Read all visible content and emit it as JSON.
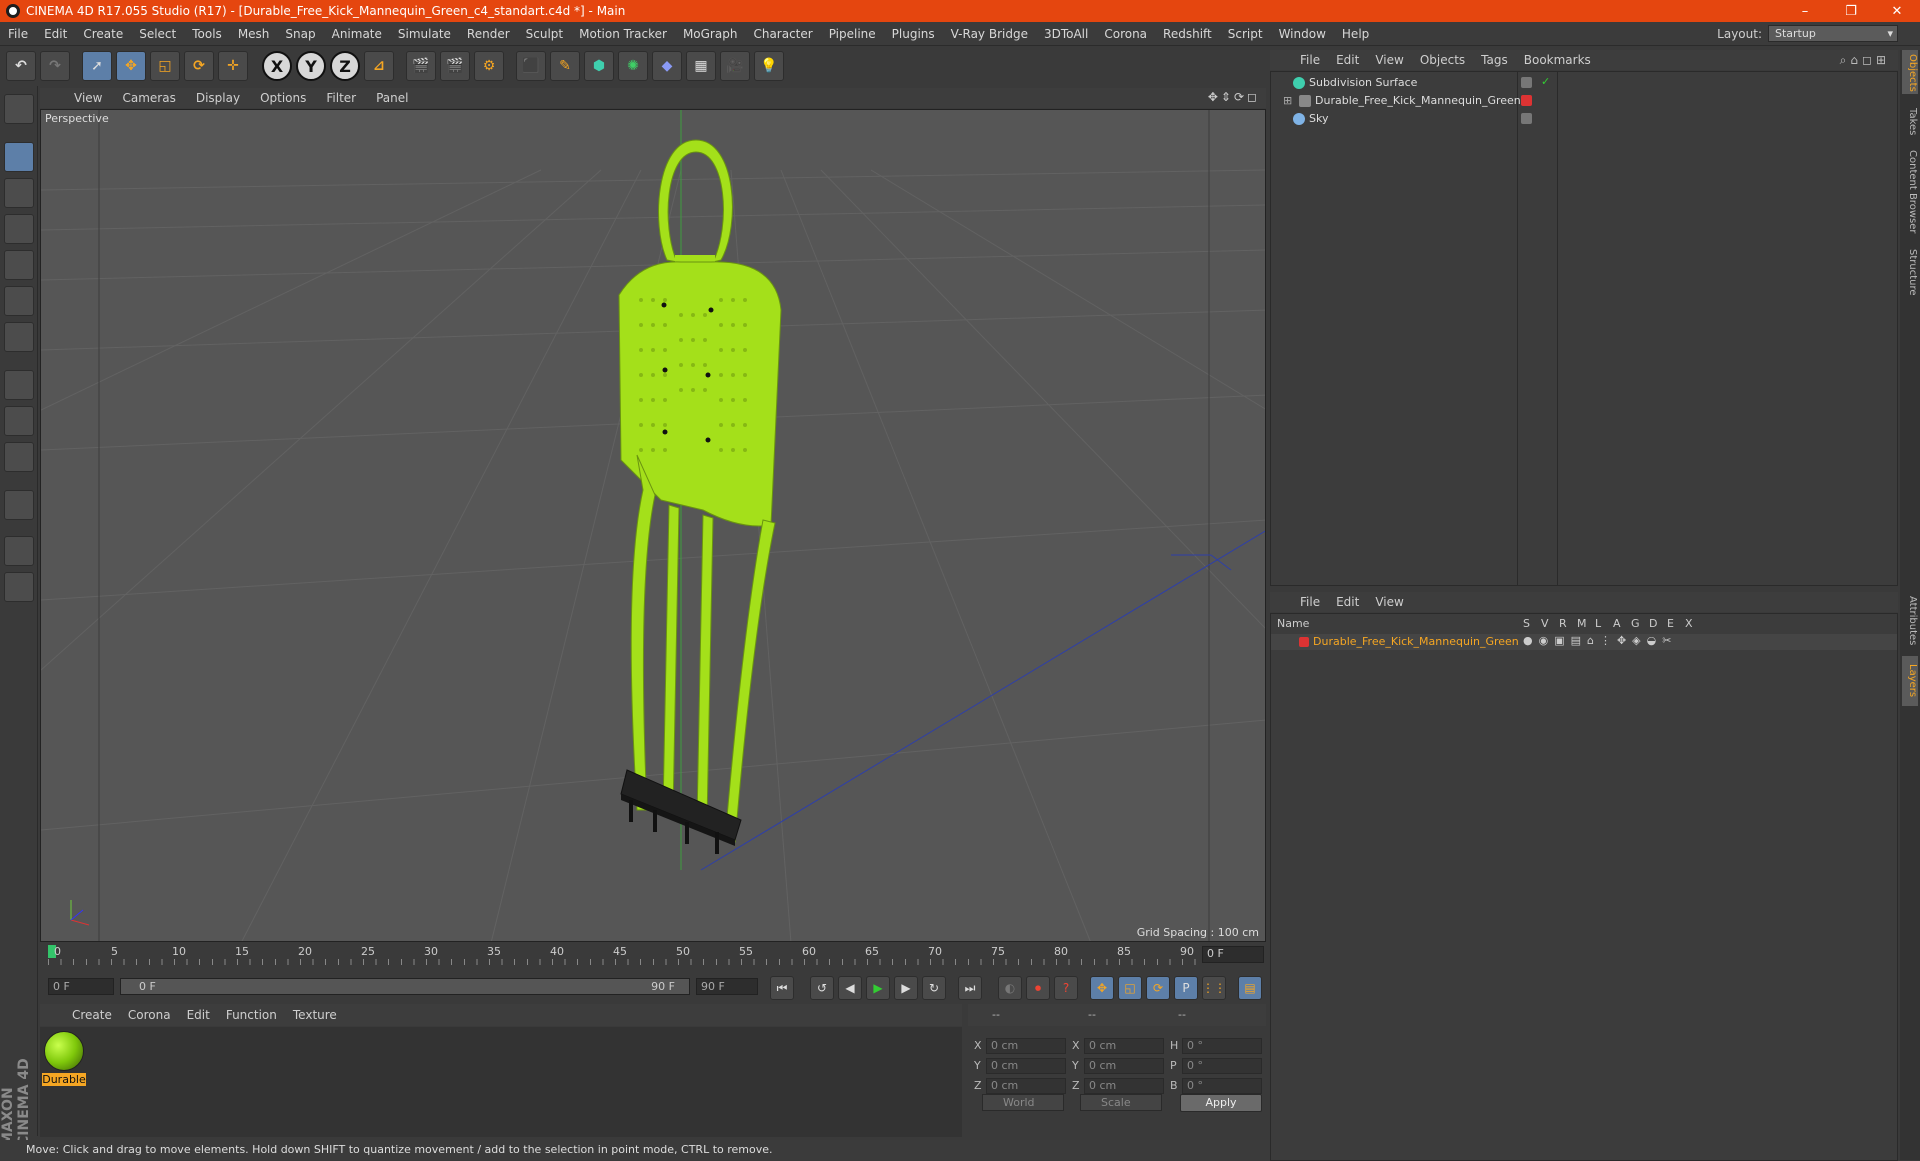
{
  "window": {
    "title": "CINEMA 4D R17.055 Studio (R17) - [Durable_Free_Kick_Mannequin_Green_c4_standart.c4d *] - Main",
    "minimize": "–",
    "restore": "❐",
    "close": "✕"
  },
  "menubar": {
    "items": [
      "File",
      "Edit",
      "Create",
      "Select",
      "Tools",
      "Mesh",
      "Snap",
      "Animate",
      "Simulate",
      "Render",
      "Sculpt",
      "Motion Tracker",
      "MoGraph",
      "Character",
      "Pipeline",
      "Plugins",
      "V-Ray Bridge",
      "3DToAll",
      "Corona",
      "Redshift",
      "Script",
      "Window",
      "Help"
    ],
    "layout_label": "Layout:",
    "layout_value": "Startup"
  },
  "toolbar": {
    "axis_x": "X",
    "axis_y": "Y",
    "axis_z": "Z"
  },
  "viewport": {
    "menu": [
      "View",
      "Cameras",
      "Display",
      "Options",
      "Filter",
      "Panel"
    ],
    "label": "Perspective",
    "grid_spacing": "Grid Spacing : 100 cm",
    "object_color": "#a4e01a"
  },
  "timeline": {
    "ticks": [
      "0",
      "5",
      "10",
      "15",
      "20",
      "25",
      "30",
      "35",
      "40",
      "45",
      "50",
      "55",
      "60",
      "65",
      "70",
      "75",
      "80",
      "85",
      "90"
    ],
    "current_frame": "0 F"
  },
  "transport": {
    "start_field": "0 F",
    "range_start": "0 F",
    "range_end": "90 F",
    "end_field": "90 F"
  },
  "material_manager": {
    "menu": [
      "Create",
      "Corona",
      "Edit",
      "Function",
      "Texture"
    ],
    "materials": [
      {
        "name": "Durable"
      }
    ]
  },
  "coordinates": {
    "header": [
      "--",
      "--",
      "--"
    ],
    "rows": [
      {
        "a": "X",
        "av": "0 cm",
        "b": "X",
        "bv": "0 cm",
        "c": "H",
        "cv": "0 °"
      },
      {
        "a": "Y",
        "av": "0 cm",
        "b": "Y",
        "bv": "0 cm",
        "c": "P",
        "cv": "0 °"
      },
      {
        "a": "Z",
        "av": "0 cm",
        "b": "Z",
        "bv": "0 cm",
        "c": "B",
        "cv": "0 °"
      }
    ],
    "space": "World",
    "mode": "Scale",
    "apply": "Apply"
  },
  "status": "Move: Click and drag to move elements. Hold down SHIFT to quantize movement / add to the selection in point mode, CTRL to remove.",
  "objects": {
    "menu": [
      "File",
      "Edit",
      "View",
      "Objects",
      "Tags",
      "Bookmarks"
    ],
    "items": [
      {
        "name": "Subdivision Surface"
      },
      {
        "name": "Durable_Free_Kick_Mannequin_Green"
      },
      {
        "name": "Sky"
      }
    ]
  },
  "layers": {
    "menu": [
      "File",
      "Edit",
      "View"
    ],
    "name_header": "Name",
    "flags": [
      "S",
      "V",
      "R",
      "M",
      "L",
      "A",
      "G",
      "D",
      "E",
      "X"
    ],
    "items": [
      {
        "name": "Durable_Free_Kick_Mannequin_Green"
      }
    ]
  },
  "side_tabs": [
    "Objects",
    "Takes",
    "Content Browser",
    "Structure",
    "Attributes",
    "Layers"
  ],
  "branding": "MAXON CINEMA 4D",
  "colors": {
    "accent": "#f5a623",
    "titlebar": "#e5460f",
    "selection": "#5d7fa8"
  }
}
